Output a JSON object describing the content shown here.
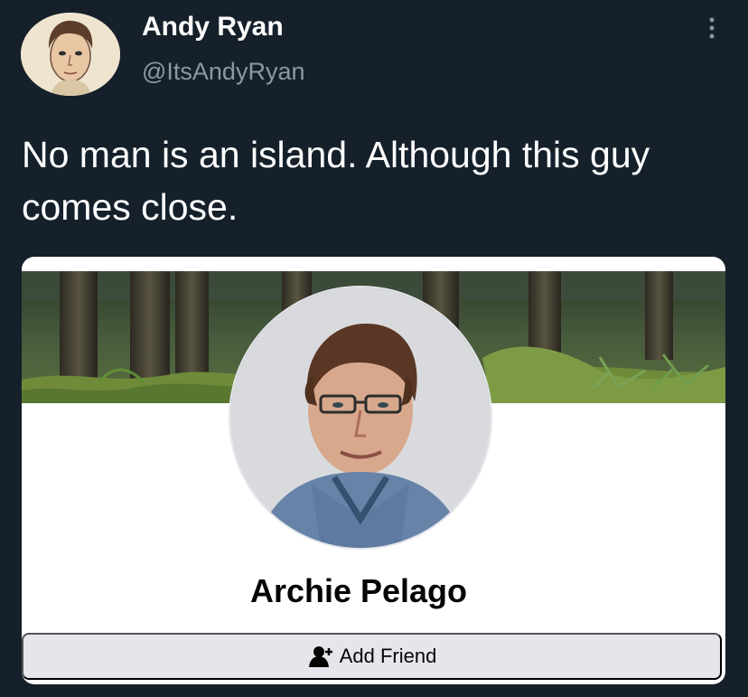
{
  "tweet": {
    "author": {
      "name": "Andy Ryan",
      "handle": "@ItsAndyRyan"
    },
    "text": "No man is an island. Although this guy comes close.",
    "more_icon": "more-vertical-icon"
  },
  "embedded_card": {
    "profile_name": "Archie Pelago",
    "add_friend_label": "Add Friend",
    "add_friend_icon": "add-person-icon"
  },
  "colors": {
    "background": "#15202b",
    "primary_text": "#ffffff",
    "secondary_text": "#8b98a5",
    "card_background": "#ffffff",
    "button_background": "#e4e6eb"
  }
}
